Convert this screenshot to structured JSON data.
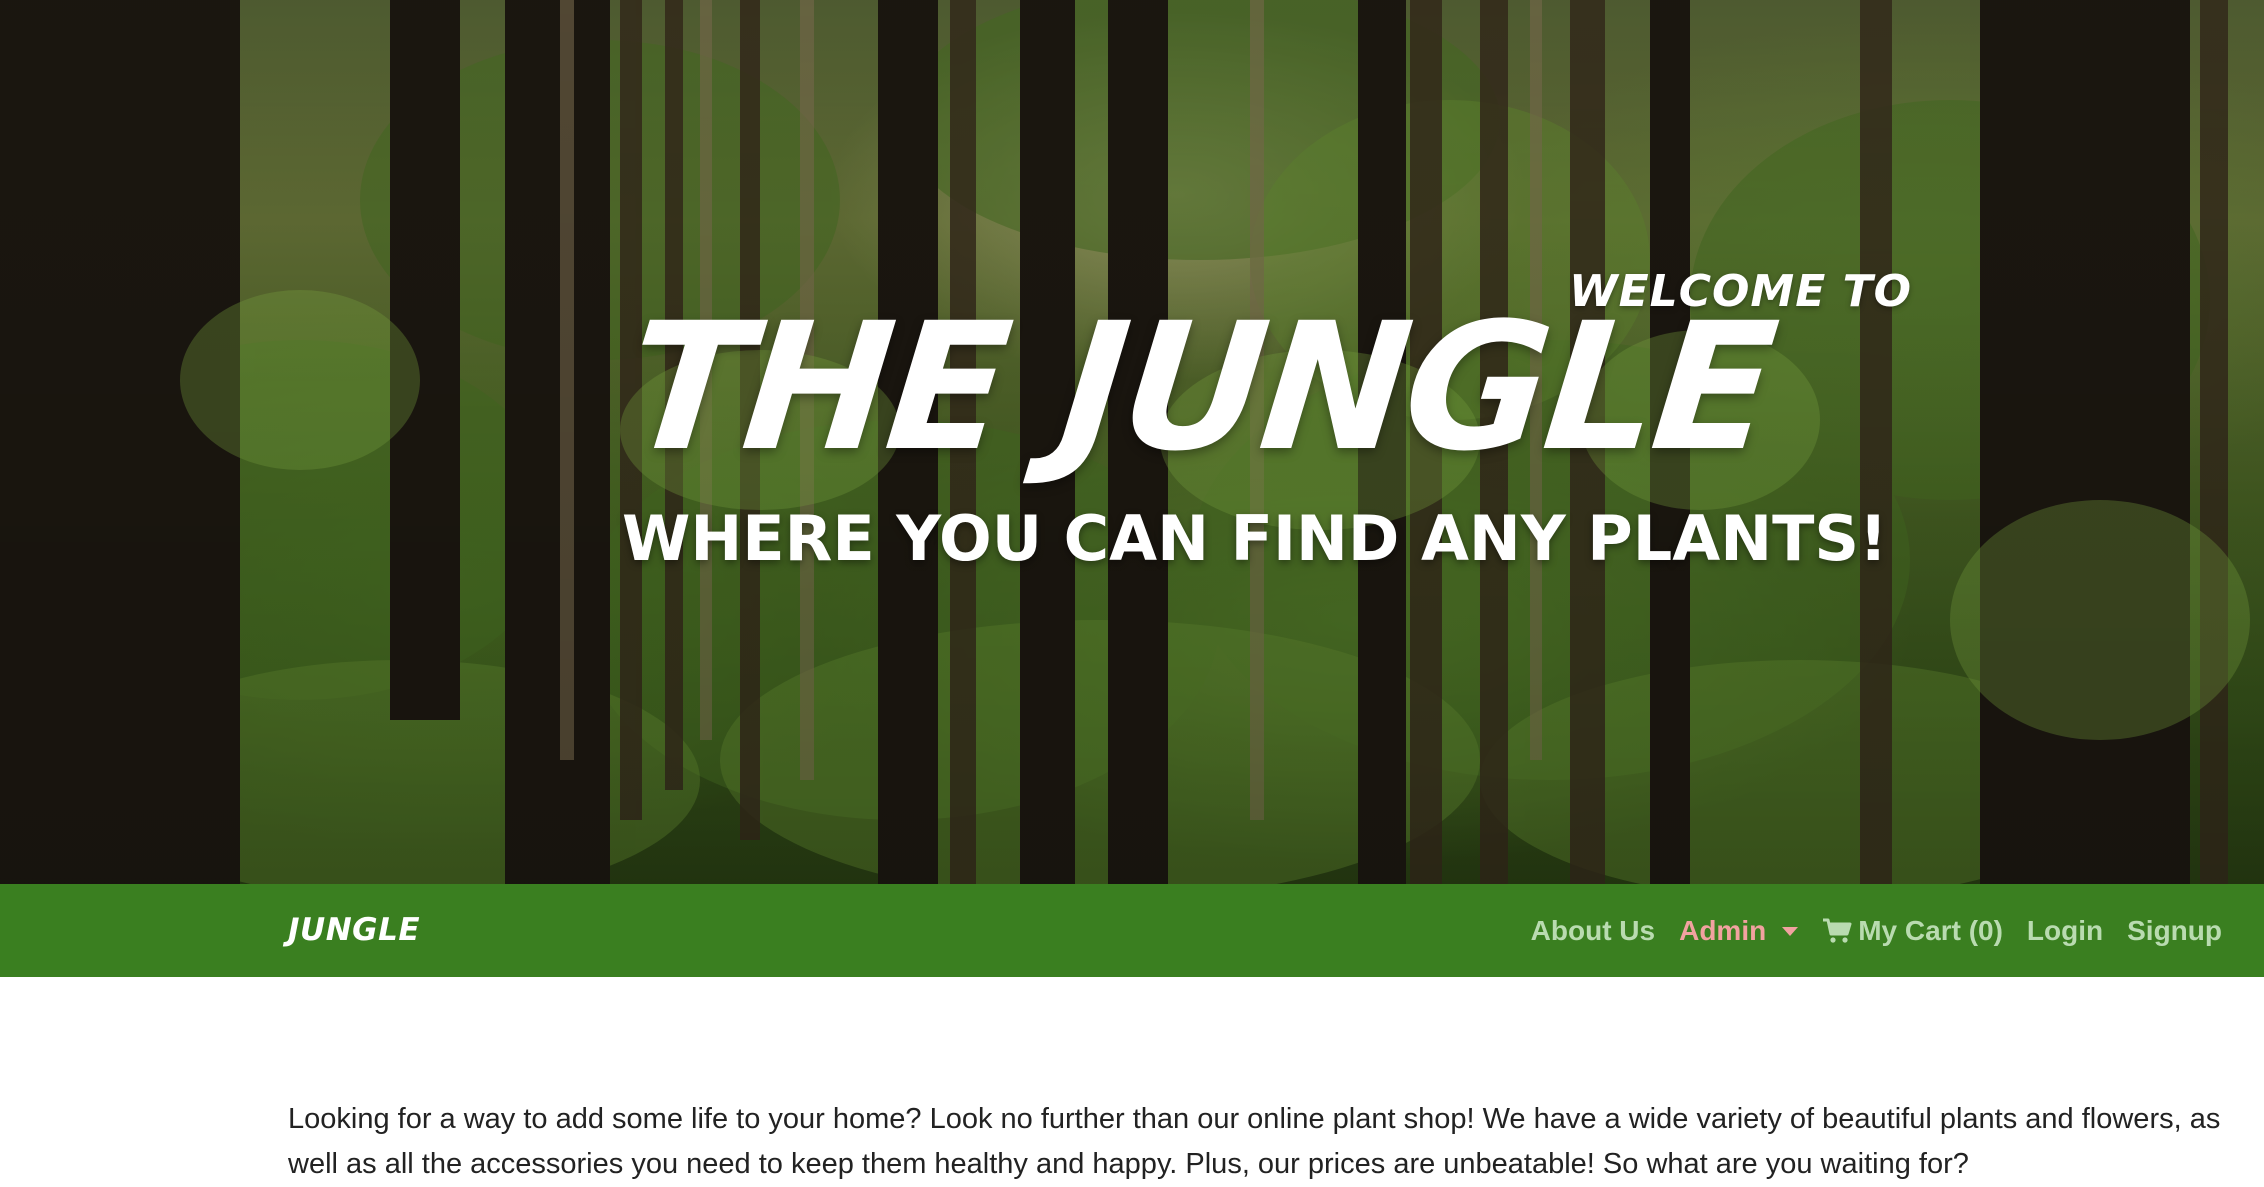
{
  "hero": {
    "welcome_text": "WELCOME TO",
    "title": "THE JUNGLE",
    "tagline": "WHERE YOU CAN FIND ANY PLANTS!"
  },
  "navbar": {
    "brand": "JUNGLE",
    "background_color": "#3a7f20",
    "links": {
      "about": "About Us",
      "admin": "Admin",
      "cart": "My Cart (0)",
      "login": "Login",
      "signup": "Signup"
    },
    "icons": {
      "admin_dropdown": "caret-down-icon",
      "cart": "shopping-cart-icon"
    },
    "link_color": "#b9dbb0",
    "admin_color": "#f2a2a0"
  },
  "intro": {
    "text": "Looking for a way to add some life to your home? Look no further than our online plant shop! We have a wide variety of beautiful plants and flowers, as well as all the accessories you need to keep them healthy and happy. Plus, our prices are unbeatable! So what are you waiting for?"
  }
}
